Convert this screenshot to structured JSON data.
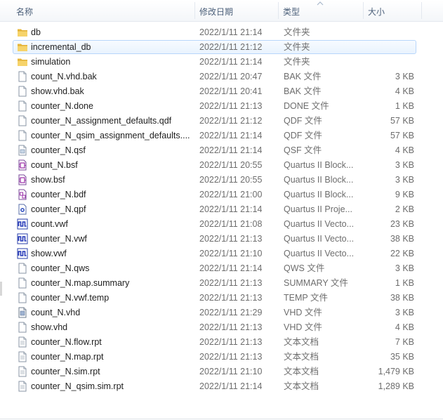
{
  "columns": {
    "name": "名称",
    "date": "修改日期",
    "type": "类型",
    "size": "大小"
  },
  "files": [
    {
      "name": "db",
      "date": "2022/1/11 21:14",
      "type": "文件夹",
      "size": "",
      "icon": "folder-icon"
    },
    {
      "name": "incremental_db",
      "date": "2022/1/11 21:12",
      "type": "文件夹",
      "size": "",
      "icon": "folder-icon",
      "selected": true
    },
    {
      "name": "simulation",
      "date": "2022/1/11 21:14",
      "type": "文件夹",
      "size": "",
      "icon": "folder-icon"
    },
    {
      "name": "count_N.vhd.bak",
      "date": "2022/1/11 20:47",
      "type": "BAK 文件",
      "size": "3 KB",
      "icon": "file-icon"
    },
    {
      "name": "show.vhd.bak",
      "date": "2022/1/11 20:41",
      "type": "BAK 文件",
      "size": "4 KB",
      "icon": "file-icon"
    },
    {
      "name": "counter_N.done",
      "date": "2022/1/11 21:13",
      "type": "DONE 文件",
      "size": "1 KB",
      "icon": "file-icon"
    },
    {
      "name": "counter_N_assignment_defaults.qdf",
      "date": "2022/1/11 21:12",
      "type": "QDF 文件",
      "size": "57 KB",
      "icon": "file-icon"
    },
    {
      "name": "counter_N_qsim_assignment_defaults....",
      "date": "2022/1/11 21:14",
      "type": "QDF 文件",
      "size": "57 KB",
      "icon": "file-icon"
    },
    {
      "name": "counter_N.qsf",
      "date": "2022/1/11 21:14",
      "type": "QSF 文件",
      "size": "4 KB",
      "icon": "settings-file-icon"
    },
    {
      "name": "count_N.bsf",
      "date": "2022/1/11 20:55",
      "type": "Quartus II Block...",
      "size": "3 KB",
      "icon": "block-symbol-icon"
    },
    {
      "name": "show.bsf",
      "date": "2022/1/11 20:55",
      "type": "Quartus II Block...",
      "size": "3 KB",
      "icon": "block-symbol-icon"
    },
    {
      "name": "counter_N.bdf",
      "date": "2022/1/11 21:00",
      "type": "Quartus II Block...",
      "size": "9 KB",
      "icon": "block-diagram-icon"
    },
    {
      "name": "counter_N.qpf",
      "date": "2022/1/11 21:14",
      "type": "Quartus II Proje...",
      "size": "2 KB",
      "icon": "project-file-icon"
    },
    {
      "name": "count.vwf",
      "date": "2022/1/11 21:08",
      "type": "Quartus II Vecto...",
      "size": "23 KB",
      "icon": "waveform-icon"
    },
    {
      "name": "counter_N.vwf",
      "date": "2022/1/11 21:13",
      "type": "Quartus II Vecto...",
      "size": "38 KB",
      "icon": "waveform-icon"
    },
    {
      "name": "show.vwf",
      "date": "2022/1/11 21:10",
      "type": "Quartus II Vecto...",
      "size": "22 KB",
      "icon": "waveform-icon"
    },
    {
      "name": "counter_N.qws",
      "date": "2022/1/11 21:14",
      "type": "QWS 文件",
      "size": "3 KB",
      "icon": "file-icon"
    },
    {
      "name": "counter_N.map.summary",
      "date": "2022/1/11 21:13",
      "type": "SUMMARY 文件",
      "size": "1 KB",
      "icon": "file-icon"
    },
    {
      "name": "counter_N.vwf.temp",
      "date": "2022/1/11 21:13",
      "type": "TEMP 文件",
      "size": "38 KB",
      "icon": "file-icon"
    },
    {
      "name": "count_N.vhd",
      "date": "2022/1/11 21:29",
      "type": "VHD 文件",
      "size": "3 KB",
      "icon": "vhdl-file-icon"
    },
    {
      "name": "show.vhd",
      "date": "2022/1/11 21:13",
      "type": "VHD 文件",
      "size": "4 KB",
      "icon": "file-icon"
    },
    {
      "name": "counter_N.flow.rpt",
      "date": "2022/1/11 21:13",
      "type": "文本文档",
      "size": "7 KB",
      "icon": "text-file-icon"
    },
    {
      "name": "counter_N.map.rpt",
      "date": "2022/1/11 21:13",
      "type": "文本文档",
      "size": "35 KB",
      "icon": "text-file-icon"
    },
    {
      "name": "counter_N.sim.rpt",
      "date": "2022/1/11 21:10",
      "type": "文本文档",
      "size": "1,479 KB",
      "icon": "text-file-icon"
    },
    {
      "name": "counter_N_qsim.sim.rpt",
      "date": "2022/1/11 21:14",
      "type": "文本文档",
      "size": "1,289 KB",
      "icon": "text-file-icon"
    }
  ]
}
